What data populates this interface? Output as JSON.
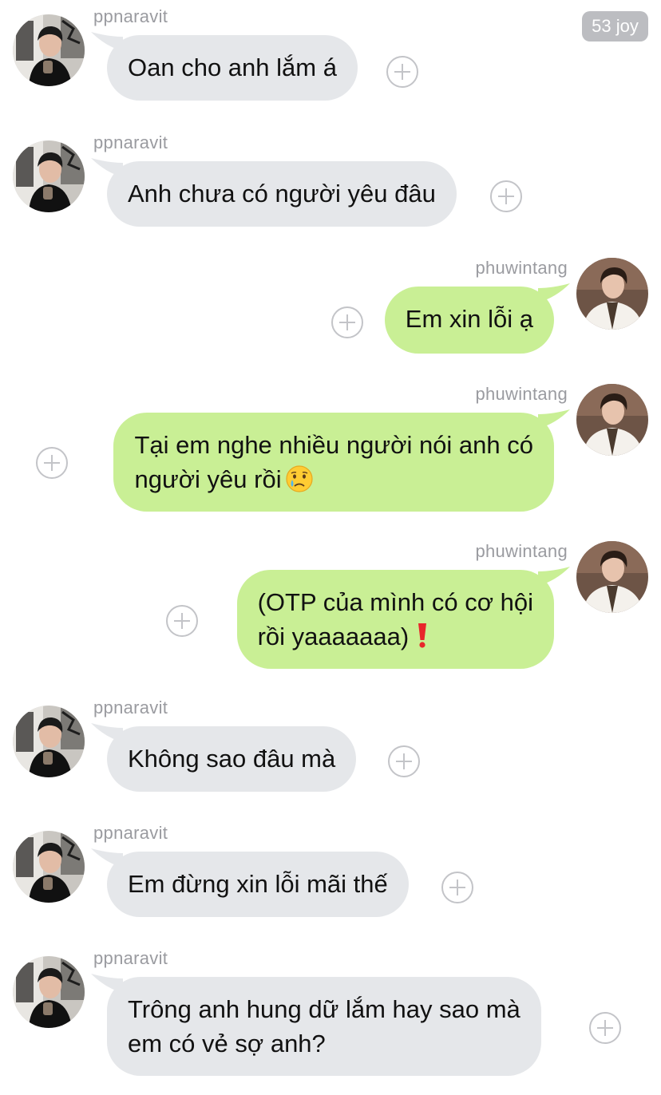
{
  "badge": "53 joy",
  "users": {
    "left": "ppnaravit",
    "right": "phuwintang"
  },
  "messages": [
    {
      "sender": "ppnaravit",
      "text": "Oan cho anh lắm á"
    },
    {
      "sender": "ppnaravit",
      "text": "Anh chưa có người yêu đâu"
    },
    {
      "sender": "phuwintang",
      "text": "Em xin lỗi ạ"
    },
    {
      "sender": "phuwintang",
      "line1": "Tại em nghe nhiều người nói anh có",
      "line2": "người yêu rồi",
      "emoji": "crying-face"
    },
    {
      "sender": "phuwintang",
      "line1": "(OTP của mình có cơ hội",
      "line2": "rồi yaaaaaaa)",
      "emoji": "red-exclamation"
    },
    {
      "sender": "ppnaravit",
      "text": "Không sao đâu mà"
    },
    {
      "sender": "ppnaravit",
      "text": "Em đừng xin lỗi mãi thế"
    },
    {
      "sender": "ppnaravit",
      "line1": "Trông anh hung dữ lắm hay sao mà",
      "line2": "em có vẻ sợ anh?"
    }
  ],
  "colors": {
    "incoming_bubble": "#e5e7ea",
    "outgoing_bubble": "#c9ef95",
    "username": "#9a9ba0",
    "badge_bg": "#bcbdc1"
  },
  "icons": {
    "react": "plus-circle-icon",
    "avatar_left": "avatar",
    "avatar_right": "avatar"
  }
}
